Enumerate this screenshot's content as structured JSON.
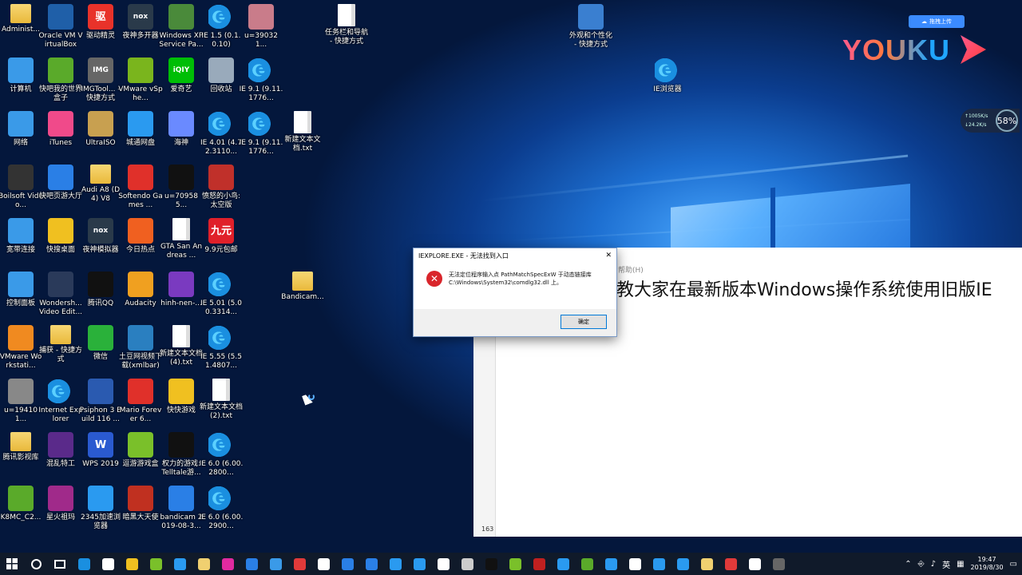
{
  "desktop": {
    "icons": [
      {
        "label": "Administ...",
        "icon": "user-folder-icon",
        "color": "#e9b93b"
      },
      {
        "label": "Oracle VM VirtualBox",
        "icon": "virtualbox-icon",
        "color": "#1f5fa8"
      },
      {
        "label": "驱动精灵",
        "icon": "driver-genius-icon",
        "color": "#e8322a",
        "glyph": "驱"
      },
      {
        "label": "夜神多开器",
        "icon": "nox-multi-icon",
        "color": "#2a3a4a",
        "glyph": "nox"
      },
      {
        "label": "Windows XP Service Pa...",
        "icon": "xp-image-icon",
        "color": "#4a8a3a"
      },
      {
        "label": "IE 1.5 (0.1.0.10)",
        "icon": "ie-search-icon",
        "color": "#1a8fe0"
      },
      {
        "label": "u=390321...",
        "icon": "photo-icon",
        "color": "#c97c8a"
      },
      {
        "label": "任务栏和导航 - 快捷方式",
        "icon": "shortcut-doc-icon",
        "color": "#ffffff"
      },
      {
        "label": "外观和个性化 - 快捷方式",
        "icon": "personalize-icon",
        "color": "#3a7fd0"
      },
      {
        "label": "计算机",
        "icon": "computer-icon",
        "color": "#3a9ae8"
      },
      {
        "label": "快吧我的世界盒子",
        "icon": "minecraft-box-icon",
        "color": "#5aaa2a"
      },
      {
        "label": "IMGTool... - 快捷方式",
        "icon": "imgtool-icon",
        "color": "#666666",
        "glyph": "IMG"
      },
      {
        "label": "VMware vSphe...",
        "icon": "vmware-vsphere-icon",
        "color": "#7ab51d"
      },
      {
        "label": "爱奇艺",
        "icon": "iqiyi-icon",
        "color": "#00be06",
        "glyph": "iQIY"
      },
      {
        "label": "回收站",
        "icon": "recycle-bin-icon",
        "color": "#9ab"
      },
      {
        "label": "IE 9.1 (9.11.1776...",
        "icon": "ie-icon",
        "color": "#1a8fe0"
      },
      {
        "label": "IE浏览器",
        "icon": "ie-browser-icon",
        "color": "#1a8fe0"
      },
      {
        "label": "网络",
        "icon": "network-icon",
        "color": "#3a9ae8"
      },
      {
        "label": "iTunes",
        "icon": "itunes-icon",
        "color": "#f04a8a"
      },
      {
        "label": "UltraISO",
        "icon": "ultraiso-icon",
        "color": "#c8a050"
      },
      {
        "label": "城通网盘",
        "icon": "ctdisk-icon",
        "color": "#2a9af0"
      },
      {
        "label": "海神",
        "icon": "haishen-icon",
        "color": "#6a8aff"
      },
      {
        "label": "IE 4.01 (4.72.3110...",
        "icon": "ie-icon",
        "color": "#1a8fe0"
      },
      {
        "label": "IE 9.1 (9.11.1776...",
        "icon": "ie-icon",
        "color": "#1a8fe0"
      },
      {
        "label": "新建文本文档.txt",
        "icon": "text-file-icon",
        "color": "#ffffff"
      },
      {
        "label": "Boilsoft Video...",
        "icon": "boilsoft-icon",
        "color": "#333"
      },
      {
        "label": "快吧页游大厅",
        "icon": "webgame-hall-icon",
        "color": "#2a7fe6"
      },
      {
        "label": "Audi A8 (D4) V8",
        "icon": "folder-doc-icon",
        "color": "#f0d070"
      },
      {
        "label": "Softendo Games ...",
        "icon": "mario-icon",
        "color": "#e0302a"
      },
      {
        "label": "u=709585...",
        "icon": "photo-dark-icon",
        "color": "#111"
      },
      {
        "label": "愤怒的小鸟:太空版",
        "icon": "angry-birds-icon",
        "color": "#c0302a"
      },
      {
        "label": "宽带连接",
        "icon": "broadband-icon",
        "color": "#3a9ae8"
      },
      {
        "label": "快搜桌面",
        "icon": "kuaisou-icon",
        "color": "#f0c020"
      },
      {
        "label": "夜神模拟器",
        "icon": "nox-player-icon",
        "color": "#2a3a4a",
        "glyph": "nox"
      },
      {
        "label": "今日热点",
        "icon": "hot-news-icon",
        "color": "#f06020"
      },
      {
        "label": "GTA San Andreas ...",
        "icon": "text-file-icon",
        "color": "#ffffff"
      },
      {
        "label": "9.9元包邮",
        "icon": "deal-icon",
        "color": "#e0202a",
        "glyph": "九元"
      },
      {
        "label": "控制面板",
        "icon": "control-panel-icon",
        "color": "#3a9ae8"
      },
      {
        "label": "Wondersh... Video Edit...",
        "icon": "filmora-icon",
        "color": "#2a3a5a"
      },
      {
        "label": "腾讯QQ",
        "icon": "qq-icon",
        "color": "#111"
      },
      {
        "label": "Audacity",
        "icon": "audacity-icon",
        "color": "#f0a020"
      },
      {
        "label": "hinh-nen-...",
        "icon": "wallpaper-icon",
        "color": "#7a3ac0"
      },
      {
        "label": "IE 5.01 (5.00.3314...",
        "icon": "ie-icon",
        "color": "#1a8fe0"
      },
      {
        "label": "Bandicam...",
        "icon": "folder-icon",
        "color": "#f0d070"
      },
      {
        "label": "VMware Workstati...",
        "icon": "vmware-icon",
        "color": "#f08a20"
      },
      {
        "label": "捕获 - 快捷方式",
        "icon": "capture-icon",
        "color": "#f0d070"
      },
      {
        "label": "微信",
        "icon": "wechat-icon",
        "color": "#2ab13a"
      },
      {
        "label": "土豆网视频下载(xmlbar)",
        "icon": "tudou-icon",
        "color": "#2a7fc0"
      },
      {
        "label": "新建文本文档(4).txt",
        "icon": "text-file-icon",
        "color": "#ffffff"
      },
      {
        "label": "IE 5.55 (5.51.4807...",
        "icon": "ie-icon",
        "color": "#1a8fe0"
      },
      {
        "label": "u=194101...",
        "icon": "photo-icon",
        "color": "#888"
      },
      {
        "label": "Internet Explorer",
        "icon": "ie-icon",
        "color": "#1a8fe0"
      },
      {
        "label": "Psiphon 3 Build 116 ...",
        "icon": "psiphon-icon",
        "color": "#2a5ab0"
      },
      {
        "label": "Mario Forever 6...",
        "icon": "mario-icon",
        "color": "#e0302a"
      },
      {
        "label": "快快游戏",
        "icon": "kuaikuai-icon",
        "color": "#f0c020"
      },
      {
        "label": "新建文本文档(2).txt",
        "icon": "text-file-icon",
        "color": "#ffffff"
      },
      {
        "label": "腾讯影视库",
        "icon": "tencent-video-icon",
        "color": "#f0c020"
      },
      {
        "label": "混乱特工",
        "icon": "agents-icon",
        "color": "#5a2a8a"
      },
      {
        "label": "WPS 2019",
        "icon": "wps-icon",
        "color": "#2a5ad0",
        "glyph": "W"
      },
      {
        "label": "逗游游戏盒",
        "icon": "douyou-icon",
        "color": "#7ac02a"
      },
      {
        "label": "权力的游戏: Telltale游...",
        "icon": "got-icon",
        "color": "#111"
      },
      {
        "label": "IE 6.0 (6.00.2800...",
        "icon": "ie-icon",
        "color": "#1a8fe0"
      },
      {
        "label": "K8MC_C2...",
        "icon": "minecraft-icon",
        "color": "#5aaa2a"
      },
      {
        "label": "星火祖玛",
        "icon": "zuma-icon",
        "color": "#a02a8a"
      },
      {
        "label": "2345加速浏览器",
        "icon": "2345-browser-icon",
        "color": "#2a9af0"
      },
      {
        "label": "暗黑大天使",
        "icon": "dark-angel-icon",
        "color": "#c03020"
      },
      {
        "label": "bandicam 2019-08-3...",
        "icon": "bandicam-video-icon",
        "color": "#2a7fe6"
      },
      {
        "label": "IE 6.0 (6.00.2900...",
        "icon": "ie-icon",
        "color": "#1a8fe0"
      }
    ]
  },
  "dialog": {
    "title": "IEXPLORE.EXE - 无法找到入口",
    "close": "✕",
    "message_line1": "无法定位程序输入点 PathMatchSpecExW 于动态链接库",
    "message_line2": "C:\\Windows\\System32\\comdlg32.dll 上。",
    "ok": "确定",
    "error_glyph": "✕"
  },
  "background_window": {
    "menu_hint": "帮助(H)",
    "headline": "教大家在最新版本Windows操作系统使用旧版IE",
    "status_num": "163"
  },
  "overlay": {
    "brand": "YOUKU",
    "upload_label": "拖拽上传",
    "speed_up": "↑1005K/s",
    "speed_down": "↓24.2K/s",
    "cpu_pct": "58%"
  },
  "taskbar": {
    "ime": "英",
    "time": "19:47",
    "date": "2019/8/30",
    "apps": [
      "#1a8fe0",
      "#ffffff",
      "#f0c020",
      "#7ac02a",
      "#2a9af0",
      "#f0d070",
      "#e02aa0",
      "#2a7fe6",
      "#3a9ae8",
      "#e03a3a",
      "#ffffff",
      "#2a7fe6",
      "#2a7fe6",
      "#2a9af0",
      "#2a9af0",
      "#ffffff",
      "#cccccc",
      "#111111",
      "#7ac02a",
      "#c02020",
      "#2a9af0",
      "#5aaa2a",
      "#2a9af0",
      "#ffffff",
      "#2a9af0",
      "#2a9af0",
      "#f0d070",
      "#e03a3a",
      "#ffffff",
      "#666666"
    ]
  }
}
